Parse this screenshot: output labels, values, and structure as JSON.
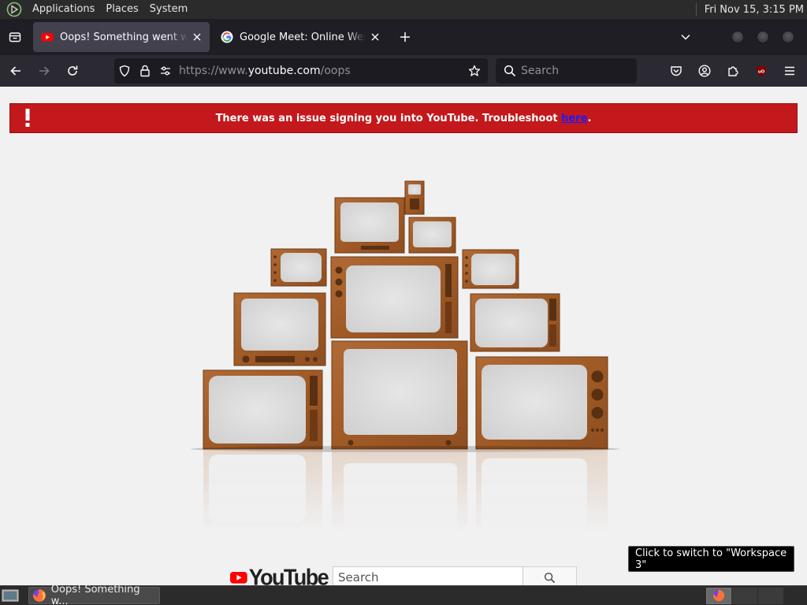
{
  "top_panel": {
    "menus": [
      "Applications",
      "Places",
      "System"
    ],
    "clock": "Fri Nov 15,  3:15 PM"
  },
  "tabs": [
    {
      "title": "Oops! Something went wrong",
      "favicon": "youtube-icon",
      "active": true
    },
    {
      "title": "Google Meet: Online Web and Video Calls",
      "favicon": "google-icon",
      "active": false
    }
  ],
  "navbar": {
    "url_dim_prefix": "https://www.",
    "url_host": "youtube.com",
    "url_path": "/oops",
    "search_placeholder": "Search"
  },
  "page": {
    "alert_text": "There was an issue signing you into YouTube. Troubleshoot ",
    "alert_link": "here",
    "alert_suffix": ".",
    "brand_word": "YouTube",
    "search_placeholder": "Search"
  },
  "tooltip": "Click to switch to \"Workspace 3\"",
  "taskbar": {
    "window_title": "Oops! Something w..."
  },
  "colors": {
    "alert_red": "#c3181c",
    "youtube_red": "#ff0000",
    "tv_wood": "#a65f2c"
  }
}
